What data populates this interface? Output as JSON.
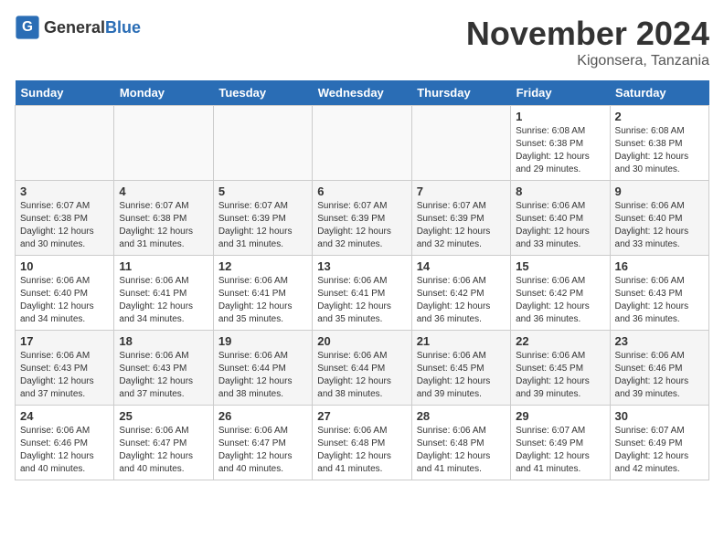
{
  "logo": {
    "general": "General",
    "blue": "Blue"
  },
  "title": "November 2024",
  "location": "Kigonsera, Tanzania",
  "days_of_week": [
    "Sunday",
    "Monday",
    "Tuesday",
    "Wednesday",
    "Thursday",
    "Friday",
    "Saturday"
  ],
  "weeks": [
    [
      {
        "day": "",
        "info": ""
      },
      {
        "day": "",
        "info": ""
      },
      {
        "day": "",
        "info": ""
      },
      {
        "day": "",
        "info": ""
      },
      {
        "day": "",
        "info": ""
      },
      {
        "day": "1",
        "info": "Sunrise: 6:08 AM\nSunset: 6:38 PM\nDaylight: 12 hours and 29 minutes."
      },
      {
        "day": "2",
        "info": "Sunrise: 6:08 AM\nSunset: 6:38 PM\nDaylight: 12 hours and 30 minutes."
      }
    ],
    [
      {
        "day": "3",
        "info": "Sunrise: 6:07 AM\nSunset: 6:38 PM\nDaylight: 12 hours and 30 minutes."
      },
      {
        "day": "4",
        "info": "Sunrise: 6:07 AM\nSunset: 6:38 PM\nDaylight: 12 hours and 31 minutes."
      },
      {
        "day": "5",
        "info": "Sunrise: 6:07 AM\nSunset: 6:39 PM\nDaylight: 12 hours and 31 minutes."
      },
      {
        "day": "6",
        "info": "Sunrise: 6:07 AM\nSunset: 6:39 PM\nDaylight: 12 hours and 32 minutes."
      },
      {
        "day": "7",
        "info": "Sunrise: 6:07 AM\nSunset: 6:39 PM\nDaylight: 12 hours and 32 minutes."
      },
      {
        "day": "8",
        "info": "Sunrise: 6:06 AM\nSunset: 6:40 PM\nDaylight: 12 hours and 33 minutes."
      },
      {
        "day": "9",
        "info": "Sunrise: 6:06 AM\nSunset: 6:40 PM\nDaylight: 12 hours and 33 minutes."
      }
    ],
    [
      {
        "day": "10",
        "info": "Sunrise: 6:06 AM\nSunset: 6:40 PM\nDaylight: 12 hours and 34 minutes."
      },
      {
        "day": "11",
        "info": "Sunrise: 6:06 AM\nSunset: 6:41 PM\nDaylight: 12 hours and 34 minutes."
      },
      {
        "day": "12",
        "info": "Sunrise: 6:06 AM\nSunset: 6:41 PM\nDaylight: 12 hours and 35 minutes."
      },
      {
        "day": "13",
        "info": "Sunrise: 6:06 AM\nSunset: 6:41 PM\nDaylight: 12 hours and 35 minutes."
      },
      {
        "day": "14",
        "info": "Sunrise: 6:06 AM\nSunset: 6:42 PM\nDaylight: 12 hours and 36 minutes."
      },
      {
        "day": "15",
        "info": "Sunrise: 6:06 AM\nSunset: 6:42 PM\nDaylight: 12 hours and 36 minutes."
      },
      {
        "day": "16",
        "info": "Sunrise: 6:06 AM\nSunset: 6:43 PM\nDaylight: 12 hours and 36 minutes."
      }
    ],
    [
      {
        "day": "17",
        "info": "Sunrise: 6:06 AM\nSunset: 6:43 PM\nDaylight: 12 hours and 37 minutes."
      },
      {
        "day": "18",
        "info": "Sunrise: 6:06 AM\nSunset: 6:43 PM\nDaylight: 12 hours and 37 minutes."
      },
      {
        "day": "19",
        "info": "Sunrise: 6:06 AM\nSunset: 6:44 PM\nDaylight: 12 hours and 38 minutes."
      },
      {
        "day": "20",
        "info": "Sunrise: 6:06 AM\nSunset: 6:44 PM\nDaylight: 12 hours and 38 minutes."
      },
      {
        "day": "21",
        "info": "Sunrise: 6:06 AM\nSunset: 6:45 PM\nDaylight: 12 hours and 39 minutes."
      },
      {
        "day": "22",
        "info": "Sunrise: 6:06 AM\nSunset: 6:45 PM\nDaylight: 12 hours and 39 minutes."
      },
      {
        "day": "23",
        "info": "Sunrise: 6:06 AM\nSunset: 6:46 PM\nDaylight: 12 hours and 39 minutes."
      }
    ],
    [
      {
        "day": "24",
        "info": "Sunrise: 6:06 AM\nSunset: 6:46 PM\nDaylight: 12 hours and 40 minutes."
      },
      {
        "day": "25",
        "info": "Sunrise: 6:06 AM\nSunset: 6:47 PM\nDaylight: 12 hours and 40 minutes."
      },
      {
        "day": "26",
        "info": "Sunrise: 6:06 AM\nSunset: 6:47 PM\nDaylight: 12 hours and 40 minutes."
      },
      {
        "day": "27",
        "info": "Sunrise: 6:06 AM\nSunset: 6:48 PM\nDaylight: 12 hours and 41 minutes."
      },
      {
        "day": "28",
        "info": "Sunrise: 6:06 AM\nSunset: 6:48 PM\nDaylight: 12 hours and 41 minutes."
      },
      {
        "day": "29",
        "info": "Sunrise: 6:07 AM\nSunset: 6:49 PM\nDaylight: 12 hours and 41 minutes."
      },
      {
        "day": "30",
        "info": "Sunrise: 6:07 AM\nSunset: 6:49 PM\nDaylight: 12 hours and 42 minutes."
      }
    ]
  ]
}
